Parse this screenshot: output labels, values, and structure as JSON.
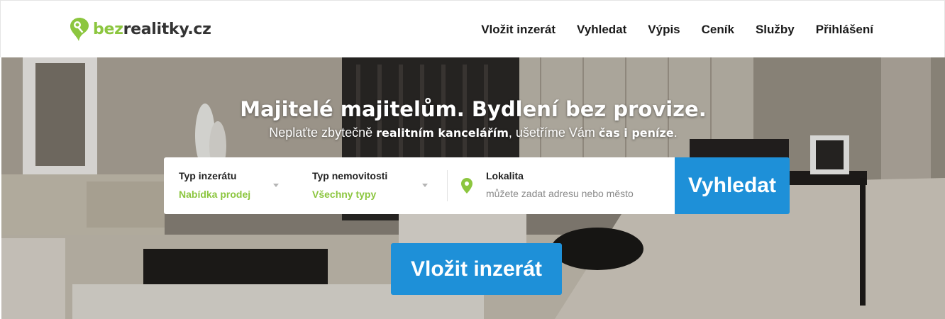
{
  "header": {
    "logo": {
      "prefix": "bez",
      "rest": "realitky.cz",
      "brand_color": "#8cc63f"
    },
    "nav": [
      {
        "label": "Vložit inzerát"
      },
      {
        "label": "Vyhledat"
      },
      {
        "label": "Výpis"
      },
      {
        "label": "Ceník"
      },
      {
        "label": "Služby"
      },
      {
        "label": "Přihlášení"
      }
    ]
  },
  "hero": {
    "title": "Majitelé majitelům. Bydlení bez provize.",
    "subtitle": {
      "part1": "Neplaťte zbytečně ",
      "bold1": "realitním kancelářím",
      "part2": ", ušetříme Vám ",
      "bold2": "čas i peníze",
      "part3": "."
    }
  },
  "search": {
    "listing_type": {
      "label": "Typ inzerátu",
      "value": "Nabídka prodej"
    },
    "property_type": {
      "label": "Typ nemovitosti",
      "value": "Všechny typy"
    },
    "location": {
      "label": "Lokalita",
      "placeholder": "můžete zadat adresu nebo město"
    },
    "submit_label": "Vyhledat"
  },
  "post_button": {
    "label": "Vložit inzerát"
  },
  "colors": {
    "accent": "#1e90d8",
    "brand_green": "#8cc63f"
  },
  "icons": {
    "location": "map-pin-icon",
    "dropdown": "caret-down-icon",
    "logo": "key-pin-icon"
  }
}
